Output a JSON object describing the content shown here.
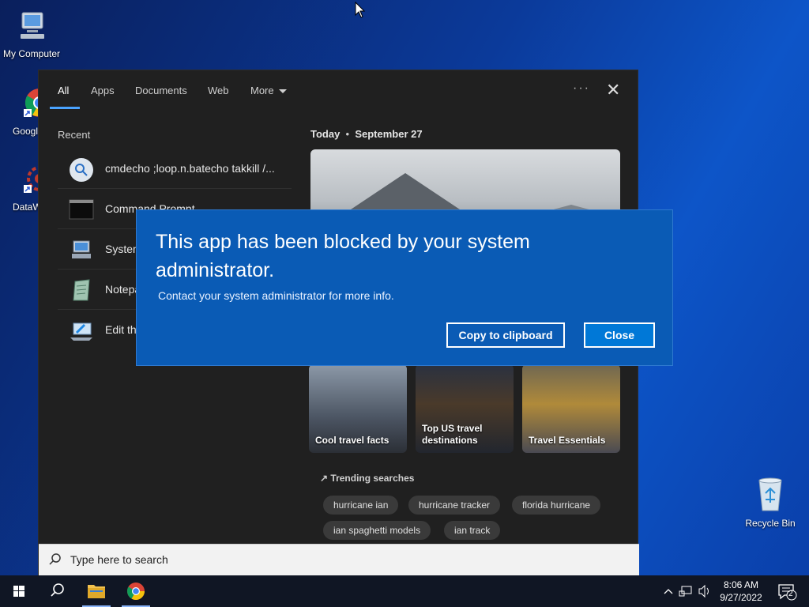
{
  "desktop": {
    "icons": [
      {
        "label": "My Computer"
      },
      {
        "label": "Google Chrome"
      },
      {
        "label": "DataWag"
      },
      {
        "label": "Recycle Bin"
      }
    ]
  },
  "search_panel": {
    "tabs": [
      "All",
      "Apps",
      "Documents",
      "Web",
      "More"
    ],
    "active_tab": "All",
    "recent_label": "Recent",
    "recent_items": [
      {
        "label": "cmdecho ;loop.n.batecho takkill /...",
        "icon": "search-icon"
      },
      {
        "label": "Command Prompt",
        "icon": "command-prompt-icon"
      },
      {
        "label": "System",
        "icon": "system-icon"
      },
      {
        "label": "Notepad",
        "icon": "notepad-icon"
      },
      {
        "label": "Edit the",
        "icon": "edit-system-icon"
      }
    ],
    "today": {
      "label": "Today",
      "date": "September 27"
    },
    "cards": [
      {
        "label": "Cool travel facts"
      },
      {
        "label": "Top US travel destinations"
      },
      {
        "label": "Travel Essentials"
      }
    ],
    "trending_label": "Trending searches",
    "trending": [
      "hurricane ian",
      "hurricane tracker",
      "florida hurricane",
      "ian spaghetti models",
      "ian track"
    ],
    "search_placeholder": "Type here to search"
  },
  "dialog": {
    "title": "This app has been blocked by your system administrator.",
    "message": "Contact your system administrator for more info.",
    "copy_button": "Copy to clipboard",
    "close_button": "Close"
  },
  "taskbar": {
    "time": "8:06 AM",
    "date": "9/27/2022",
    "notification_count": "2"
  },
  "colors": {
    "dialog_bg": "#0a5bb5",
    "accent": "#0078d7",
    "panel_bg": "#202020",
    "taskbar_bg": "#101624"
  }
}
